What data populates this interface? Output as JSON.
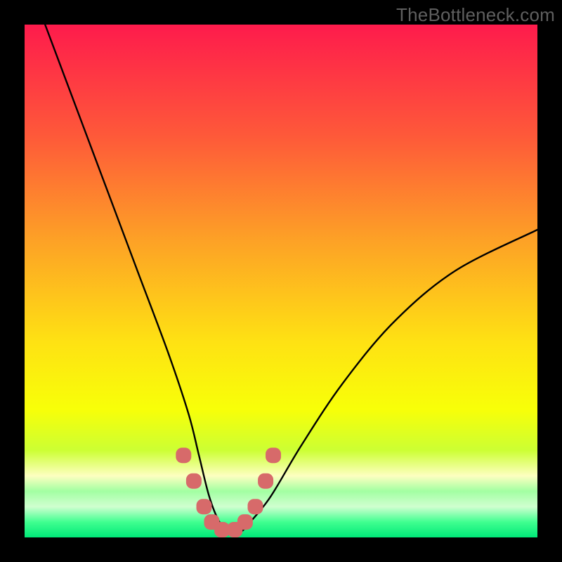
{
  "watermark": "TheBottleneck.com",
  "colors": {
    "frame": "#000000",
    "curve": "#000000",
    "marker_fill": "#d76a6a",
    "gradient_stops": [
      {
        "pct": 0,
        "color": "#fe1b4c"
      },
      {
        "pct": 22,
        "color": "#fe5a39"
      },
      {
        "pct": 42,
        "color": "#fda126"
      },
      {
        "pct": 62,
        "color": "#fee213"
      },
      {
        "pct": 75,
        "color": "#f8ff08"
      },
      {
        "pct": 83,
        "color": "#ccff33"
      },
      {
        "pct": 88,
        "color": "#fdffc0"
      },
      {
        "pct": 91,
        "color": "#a2ffa2"
      },
      {
        "pct": 94,
        "color": "#d0ffd0"
      },
      {
        "pct": 97,
        "color": "#40ff90"
      },
      {
        "pct": 100,
        "color": "#00e878"
      }
    ]
  },
  "chart_data": {
    "type": "line",
    "title": "",
    "xlabel": "",
    "ylabel": "",
    "xlim": [
      0,
      100
    ],
    "ylim": [
      0,
      100
    ],
    "series": [
      {
        "name": "bottleneck-curve",
        "x": [
          4,
          10,
          16,
          22,
          28,
          32,
          34,
          36,
          38,
          40,
          42,
          44,
          48,
          54,
          62,
          72,
          84,
          100
        ],
        "values": [
          100,
          84,
          68,
          52,
          36,
          24,
          16,
          8,
          3,
          1,
          1,
          3,
          8,
          18,
          30,
          42,
          52,
          60
        ]
      }
    ],
    "markers": {
      "name": "overlay-dots",
      "x": [
        31,
        33,
        35,
        36.5,
        38.5,
        41,
        43,
        45,
        47,
        48.5
      ],
      "values": [
        16,
        11,
        6,
        3,
        1.5,
        1.5,
        3,
        6,
        11,
        16
      ]
    }
  }
}
